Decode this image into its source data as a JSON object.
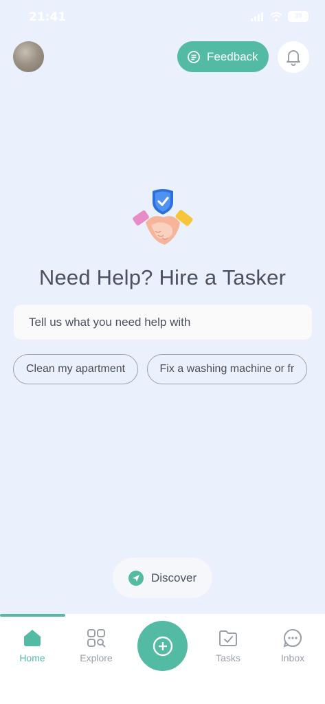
{
  "status_bar": {
    "time": "21:41",
    "battery": "39"
  },
  "header": {
    "feedback_label": "Feedback"
  },
  "hero": {
    "title": "Need Help? Hire a Tasker",
    "input_placeholder": "Tell us what you need help with",
    "suggestions": [
      "Clean my apartment",
      "Fix a washing machine or fr"
    ]
  },
  "discover": {
    "label": "Discover"
  },
  "bottom_nav": {
    "items": [
      {
        "label": "Home",
        "icon": "home-icon",
        "active": true
      },
      {
        "label": "Explore",
        "icon": "explore-icon",
        "active": false
      },
      {
        "label": "Tasks",
        "icon": "tasks-icon",
        "active": false
      },
      {
        "label": "Inbox",
        "icon": "inbox-icon",
        "active": false
      }
    ]
  },
  "colors": {
    "accent": "#53BBA4",
    "background": "#EBF0FD",
    "text": "#4A5163"
  }
}
